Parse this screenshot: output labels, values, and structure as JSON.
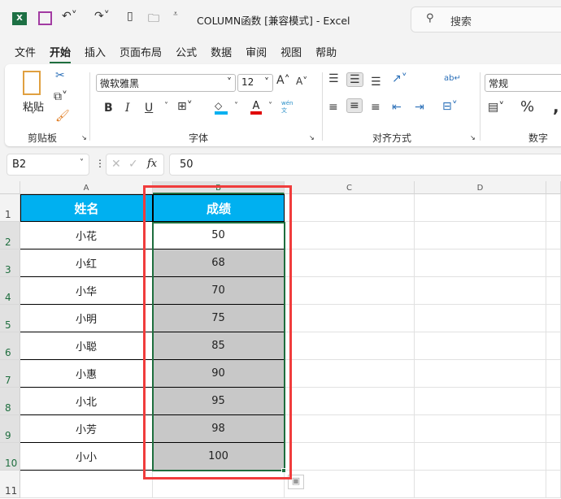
{
  "titlebar": {
    "title": "COLUMN函数  [兼容模式]  -  Excel",
    "search_placeholder": "搜索"
  },
  "menu": [
    "文件",
    "开始",
    "插入",
    "页面布局",
    "公式",
    "数据",
    "审阅",
    "视图",
    "帮助"
  ],
  "ribbon": {
    "paste": "粘贴",
    "clipboard": "剪贴板",
    "font_name": "微软雅黑",
    "font_size": "12",
    "font": "字体",
    "alignment": "对齐方式",
    "number_format": "常规",
    "number": "数字",
    "bold": "B",
    "italic": "I",
    "underline": "U",
    "font_color_letter": "A",
    "phonetic": "wén 文"
  },
  "colors": {
    "fill": "#00b0f0",
    "font": "#e00000",
    "header": "#00b0f0",
    "selection_fill": "#c8c8c8",
    "highlight_box": "#f03c3c"
  },
  "formula_bar": {
    "name_box": "B2",
    "fx": "fx",
    "value": "50"
  },
  "columns": [
    "A",
    "B",
    "C",
    "D"
  ],
  "rows": [
    "1",
    "2",
    "3",
    "4",
    "5",
    "6",
    "7",
    "8",
    "9",
    "10",
    "11"
  ],
  "table": {
    "headers": [
      "姓名",
      "成绩"
    ],
    "rows": [
      [
        "小花",
        "50"
      ],
      [
        "小红",
        "68"
      ],
      [
        "小华",
        "70"
      ],
      [
        "小明",
        "75"
      ],
      [
        "小聪",
        "85"
      ],
      [
        "小惠",
        "90"
      ],
      [
        "小北",
        "95"
      ],
      [
        "小芳",
        "98"
      ],
      [
        "小小",
        "100"
      ]
    ]
  }
}
